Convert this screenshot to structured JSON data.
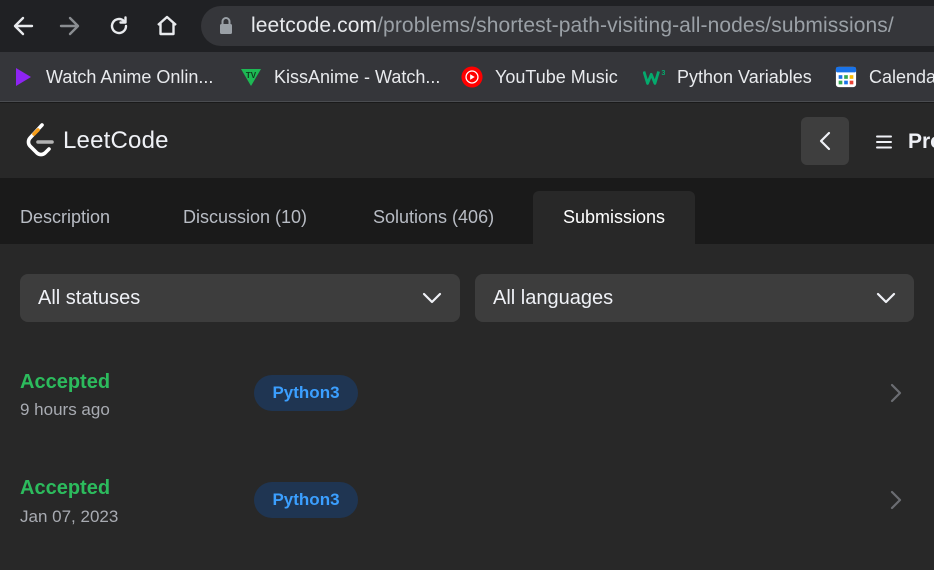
{
  "browser": {
    "url_host": "leetcode.com",
    "url_path": "/problems/shortest-path-visiting-all-nodes/submissions/",
    "bookmarks": [
      {
        "label": "Watch Anime Onlin...",
        "icon": "play-triangle-icon",
        "color": "#8e24f2"
      },
      {
        "label": "KissAnime - Watch...",
        "icon": "kissanime-tv-icon",
        "color": "#1db954"
      },
      {
        "label": "YouTube Music",
        "icon": "youtube-music-icon",
        "color": "#ff0000"
      },
      {
        "label": "Python Variables",
        "icon": "w3schools-icon",
        "color": "#04aa6d"
      },
      {
        "label": "Calenda",
        "icon": "calendar-icon",
        "color": "#1a73e8"
      }
    ]
  },
  "header": {
    "brand": "LeetCode",
    "menu_label": "Pro",
    "colors": {
      "logo_orange": "#f89f1b",
      "logo_white": "#ffffff"
    }
  },
  "tabs": [
    {
      "label": "Description",
      "active": false
    },
    {
      "label": "Discussion (10)",
      "active": false
    },
    {
      "label": "Solutions (406)",
      "active": false
    },
    {
      "label": "Submissions",
      "active": true
    }
  ],
  "filters": {
    "status": "All statuses",
    "language": "All languages"
  },
  "submissions": [
    {
      "status": "Accepted",
      "time": "9 hours ago",
      "language": "Python3"
    },
    {
      "status": "Accepted",
      "time": "Jan 07, 2023",
      "language": "Python3"
    }
  ],
  "colors": {
    "accepted": "#2cbb5d",
    "lang_badge_bg": "#1f3552",
    "lang_badge_text": "#3b9fff"
  }
}
